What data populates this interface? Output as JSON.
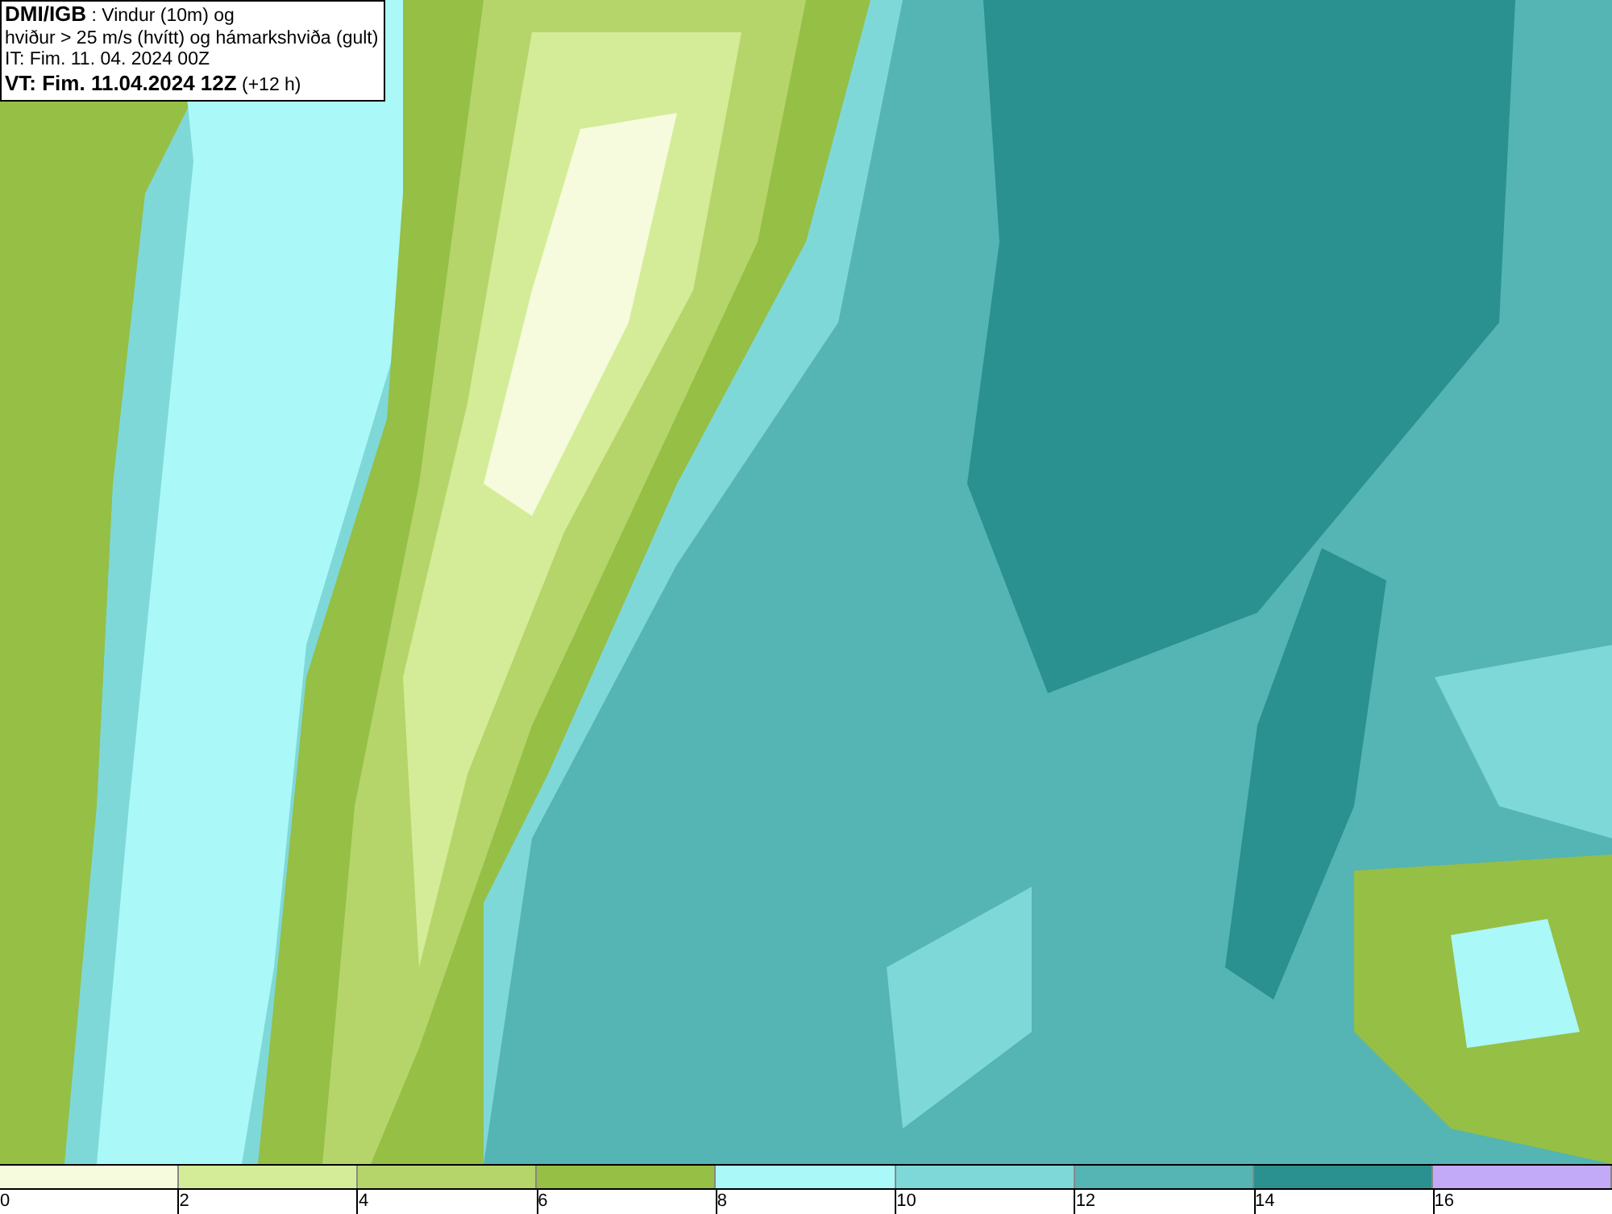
{
  "legend": [
    "**DMI/IGB** : Vindur (10m) og",
    "hviður > 25 m/s (hvítt) og hámarkshviða (gult)",
    "IT: Fim. 11. 04. 2024 00Z",
    "**VT: Fim. 11.04.2024 12Z** (+12 h)"
  ],
  "colorbar": [
    {
      "label": "0",
      "color": "#f5fbdc"
    },
    {
      "label": "2",
      "color": "#d4ec98"
    },
    {
      "label": "4",
      "color": "#b5d56a"
    },
    {
      "label": "6",
      "color": "#95bf45"
    },
    {
      "label": "8",
      "color": "#aaf8f8"
    },
    {
      "label": "10",
      "color": "#7fd8d8"
    },
    {
      "label": "12",
      "color": "#55b4b4"
    },
    {
      "label": "14",
      "color": "#2a9090"
    },
    {
      "label": "16",
      "color": "#c3aaf8"
    }
  ]
}
